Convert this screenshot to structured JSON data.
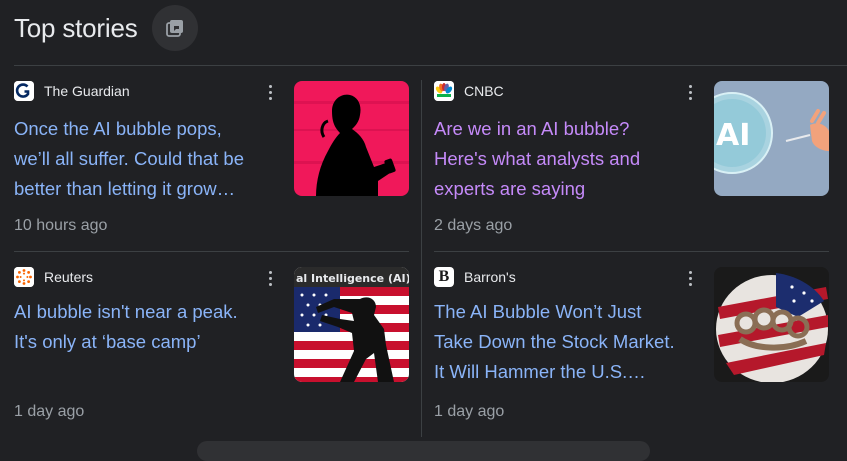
{
  "header": {
    "title": "Top stories"
  },
  "stories": [
    {
      "source": "The Guardian",
      "source_icon": "guardian-logo-icon",
      "headline_lines": [
        "Once the AI bubble pops,",
        "we’ll all suffer. Could that be",
        "better than letting it grow…"
      ],
      "time": "10 hours ago",
      "visited": false,
      "thumbnail": "silhouette-woman-with-phone-pink-background"
    },
    {
      "source": "CNBC",
      "source_icon": "cnbc-peacock-icon",
      "headline_lines": [
        "Are we in an AI bubble?",
        "Here's what analysts and",
        "experts are saying"
      ],
      "time": "2 days ago",
      "visited": true,
      "thumbnail": "ai-bubble-hand-pin-illustration"
    },
    {
      "source": "Reuters",
      "source_icon": "reuters-logo-icon",
      "headline_lines": [
        "AI bubble isn't near a peak.",
        "It's only at ‘base camp’"
      ],
      "time": "1 day ago",
      "visited": false,
      "thumbnail": "artificial-intelligence-flag-robot",
      "thumb_caption": "al Intelligence (AI)"
    },
    {
      "source": "Barron's",
      "source_icon": "barrons-b-logo-icon",
      "source_icon_letter": "B",
      "headline_lines": [
        "The AI Bubble Won’t Just",
        "Take Down the Stock Market.",
        "It Will Hammer the U.S.…"
      ],
      "time": "1 day ago",
      "visited": false,
      "thumbnail": "flag-fist-brass-knuckles"
    }
  ],
  "colors": {
    "background": "#202124",
    "link": "#8ab4f8",
    "visited_link": "#c58af9",
    "meta_text": "#9aa0a6",
    "divider": "#3c4043"
  }
}
